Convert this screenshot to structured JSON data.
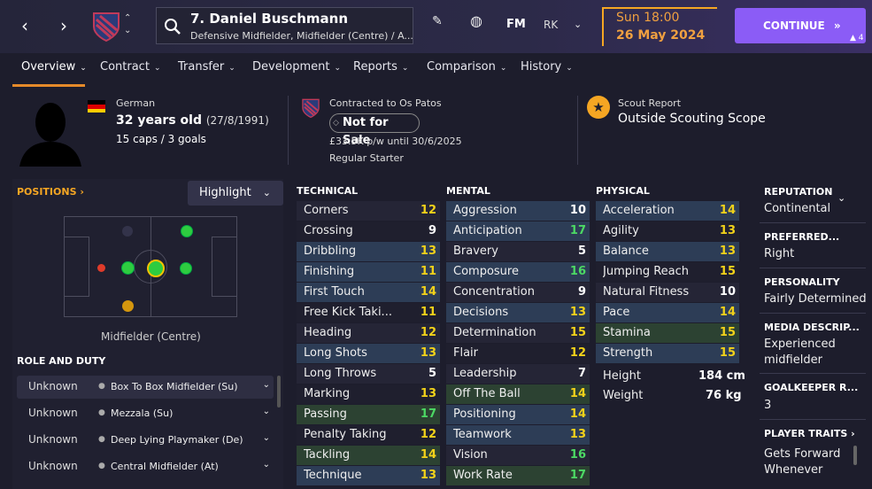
{
  "header": {
    "player_name": "7. Daniel Buschmann",
    "positions": "Defensive Midfielder, Midfielder (Centre) / A...",
    "fm_label": "FM",
    "rk_label": "RK",
    "day_time": "Sun 18:00",
    "date": "26 May 2024",
    "continue_label": "CONTINUE",
    "badge_count": "4"
  },
  "tabs": [
    "Overview",
    "Contract",
    "Transfer",
    "Development",
    "Reports",
    "Comparison",
    "History"
  ],
  "info": {
    "nationality": "German",
    "age": "32 years old",
    "dob": "(27/8/1991)",
    "caps": "15 caps / 3 goals",
    "contract_title": "Contracted to Os Patos",
    "transfer_status": "Not for Sale",
    "wage": "£33.5K p/w until 30/6/2025",
    "squad_status": "Regular Starter",
    "scout_title": "Scout Report",
    "scout_value": "Outside Scouting Scope"
  },
  "positions_panel": {
    "label": "POSITIONS",
    "highlight_label": "Highlight",
    "position_name": "Midfielder (Centre)",
    "role_label": "ROLE AND DUTY",
    "roles": [
      {
        "rating": "Unknown",
        "role": "Box To Box Midfielder (Su)"
      },
      {
        "rating": "Unknown",
        "role": "Mezzala (Su)"
      },
      {
        "rating": "Unknown",
        "role": "Deep Lying Playmaker (De)"
      },
      {
        "rating": "Unknown",
        "role": "Central Midfielder (At)"
      }
    ]
  },
  "technical": {
    "title": "TECHNICAL",
    "items": [
      {
        "name": "Corners",
        "value": "12"
      },
      {
        "name": "Crossing",
        "value": "9"
      },
      {
        "name": "Dribbling",
        "value": "13"
      },
      {
        "name": "Finishing",
        "value": "11"
      },
      {
        "name": "First Touch",
        "value": "14"
      },
      {
        "name": "Free Kick Taki...",
        "value": "11"
      },
      {
        "name": "Heading",
        "value": "12"
      },
      {
        "name": "Long Shots",
        "value": "13"
      },
      {
        "name": "Long Throws",
        "value": "5"
      },
      {
        "name": "Marking",
        "value": "13"
      },
      {
        "name": "Passing",
        "value": "17"
      },
      {
        "name": "Penalty Taking",
        "value": "12"
      },
      {
        "name": "Tackling",
        "value": "14"
      },
      {
        "name": "Technique",
        "value": "13"
      }
    ]
  },
  "mental": {
    "title": "MENTAL",
    "items": [
      {
        "name": "Aggression",
        "value": "10"
      },
      {
        "name": "Anticipation",
        "value": "17"
      },
      {
        "name": "Bravery",
        "value": "5"
      },
      {
        "name": "Composure",
        "value": "16"
      },
      {
        "name": "Concentration",
        "value": "9"
      },
      {
        "name": "Decisions",
        "value": "13"
      },
      {
        "name": "Determination",
        "value": "15"
      },
      {
        "name": "Flair",
        "value": "12"
      },
      {
        "name": "Leadership",
        "value": "7"
      },
      {
        "name": "Off The Ball",
        "value": "14"
      },
      {
        "name": "Positioning",
        "value": "14"
      },
      {
        "name": "Teamwork",
        "value": "13"
      },
      {
        "name": "Vision",
        "value": "16"
      },
      {
        "name": "Work Rate",
        "value": "17"
      }
    ]
  },
  "physical": {
    "title": "PHYSICAL",
    "items": [
      {
        "name": "Acceleration",
        "value": "14"
      },
      {
        "name": "Agility",
        "value": "13"
      },
      {
        "name": "Balance",
        "value": "13"
      },
      {
        "name": "Jumping Reach",
        "value": "15"
      },
      {
        "name": "Natural Fitness",
        "value": "10"
      },
      {
        "name": "Pace",
        "value": "14"
      },
      {
        "name": "Stamina",
        "value": "15"
      },
      {
        "name": "Strength",
        "value": "15"
      }
    ],
    "height_label": "Height",
    "height_value": "184 cm",
    "weight_label": "Weight",
    "weight_value": "76 kg"
  },
  "profile": {
    "reputation_label": "REPUTATION",
    "reputation_value": "Continental",
    "foot_label": "PREFERRED...",
    "foot_value": "Right",
    "personality_label": "PERSONALITY",
    "personality_value": "Fairly Determined",
    "media_label": "MEDIA DESCRIP...",
    "media_value_1": "Experienced",
    "media_value_2": "midfielder",
    "gk_label": "GOALKEEPER R...",
    "gk_value": "3",
    "traits_label": "PLAYER TRAITS",
    "traits_value_1": "Gets Forward",
    "traits_value_2": "Whenever"
  },
  "colors": {
    "accent": "#8b5cf6",
    "orange": "#f5a623",
    "value_green": "#4cd964",
    "value_yellow": "#f2d21a",
    "value_white": "#ffffff"
  }
}
